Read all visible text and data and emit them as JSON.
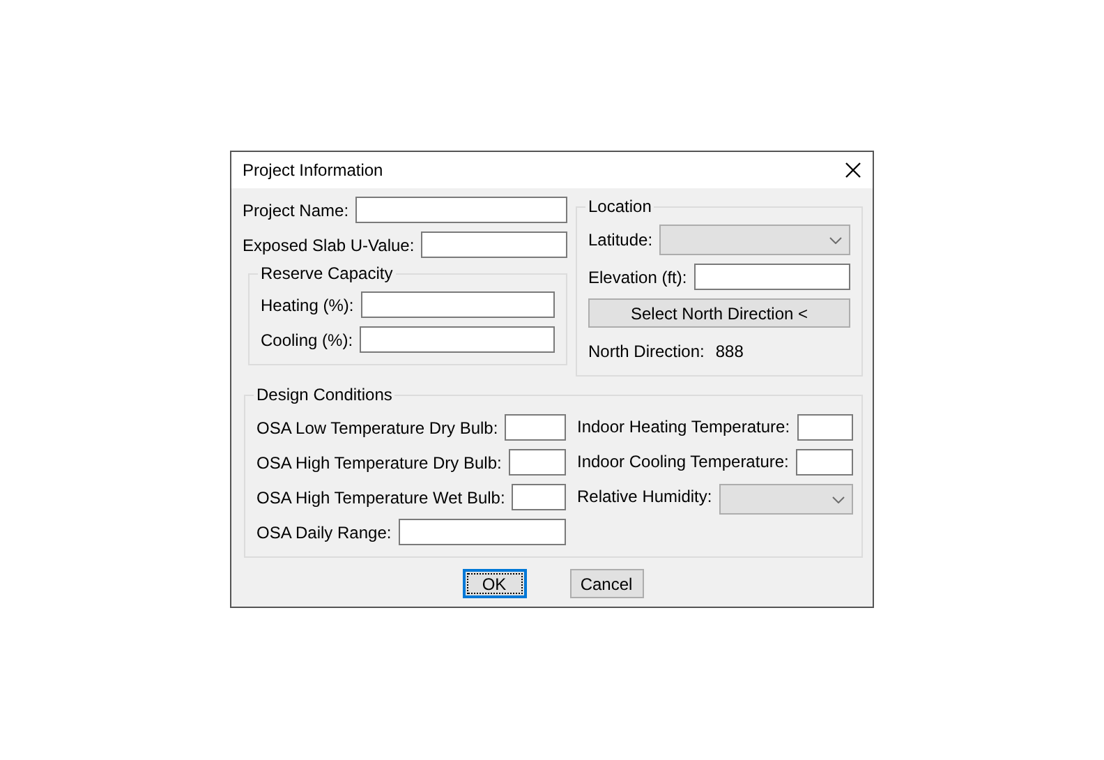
{
  "window": {
    "title": "Project Information"
  },
  "project_fields": [
    {
      "label": "Project Name:",
      "kind": "text"
    },
    {
      "label": "Exposed Slab U-Value:",
      "kind": "text"
    }
  ],
  "reserve_capacity": {
    "title": "Reserve Capacity",
    "fields": [
      {
        "label": "Heating (%):",
        "kind": "text"
      },
      {
        "label": "Cooling (%):",
        "kind": "text"
      }
    ]
  },
  "location": {
    "title": "Location",
    "fields": [
      {
        "label": "Latitude:",
        "kind": "select",
        "disabled": true
      },
      {
        "label": "Elevation (ft):",
        "kind": "text"
      }
    ],
    "button": "Select North Direction <",
    "north_direction": {
      "label": "North Direction:",
      "value": "888"
    }
  },
  "design_conditions": {
    "title": "Design Conditions",
    "left": [
      {
        "label": "OSA Low Temperature Dry Bulb:",
        "kind": "text"
      },
      {
        "label": "OSA High Temperature Dry Bulb:",
        "kind": "text"
      },
      {
        "label": "OSA High Temperature Wet Bulb:",
        "kind": "text"
      },
      {
        "label": "OSA Daily Range:",
        "kind": "text"
      }
    ],
    "right": [
      {
        "label": "Indoor Heating Temperature:",
        "kind": "text"
      },
      {
        "label": "Indoor Cooling Temperature:",
        "kind": "text"
      },
      {
        "label": "Relative Humidity:",
        "kind": "select",
        "disabled": true
      }
    ]
  },
  "buttons": [
    {
      "label": "OK",
      "focused": true
    },
    {
      "label": "Cancel",
      "focused": false
    }
  ]
}
